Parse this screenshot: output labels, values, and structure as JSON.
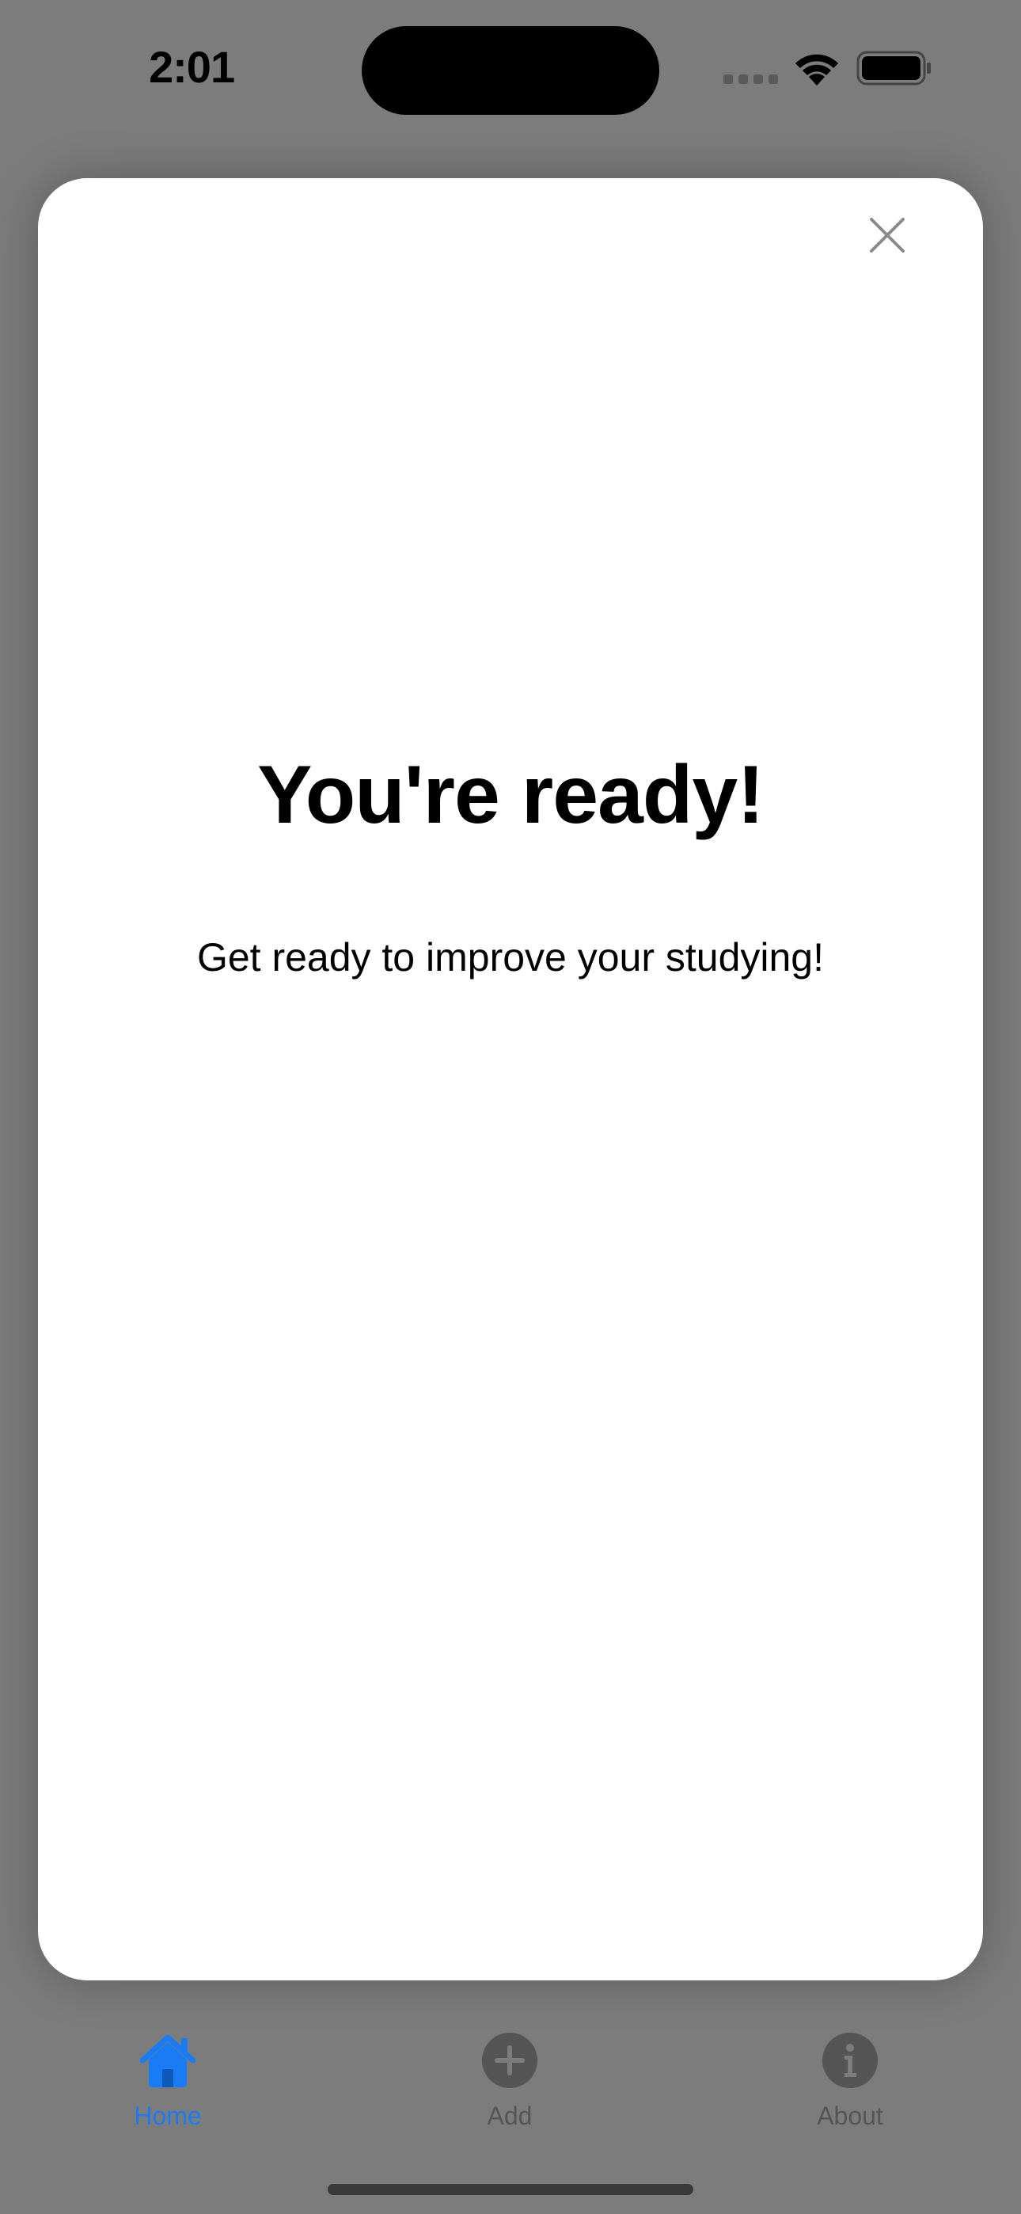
{
  "status_bar": {
    "time": "2:01"
  },
  "modal": {
    "title": "You're ready!",
    "subtitle": "Get ready to improve your studying!",
    "close_icon": "close-icon"
  },
  "tab_bar": {
    "items": [
      {
        "label": "Home",
        "icon": "house-fill-icon",
        "selected": true
      },
      {
        "label": "Add",
        "icon": "plus-circle-fill-icon",
        "selected": false
      },
      {
        "label": "About",
        "icon": "info-circle-fill-icon",
        "selected": false
      }
    ]
  },
  "colors": {
    "accent": "#1a7cf5",
    "inactive_tab": "#555555",
    "dimmed_background": "#7c7c7c",
    "card": "#ffffff",
    "close_icon": "#8a8a8a"
  }
}
